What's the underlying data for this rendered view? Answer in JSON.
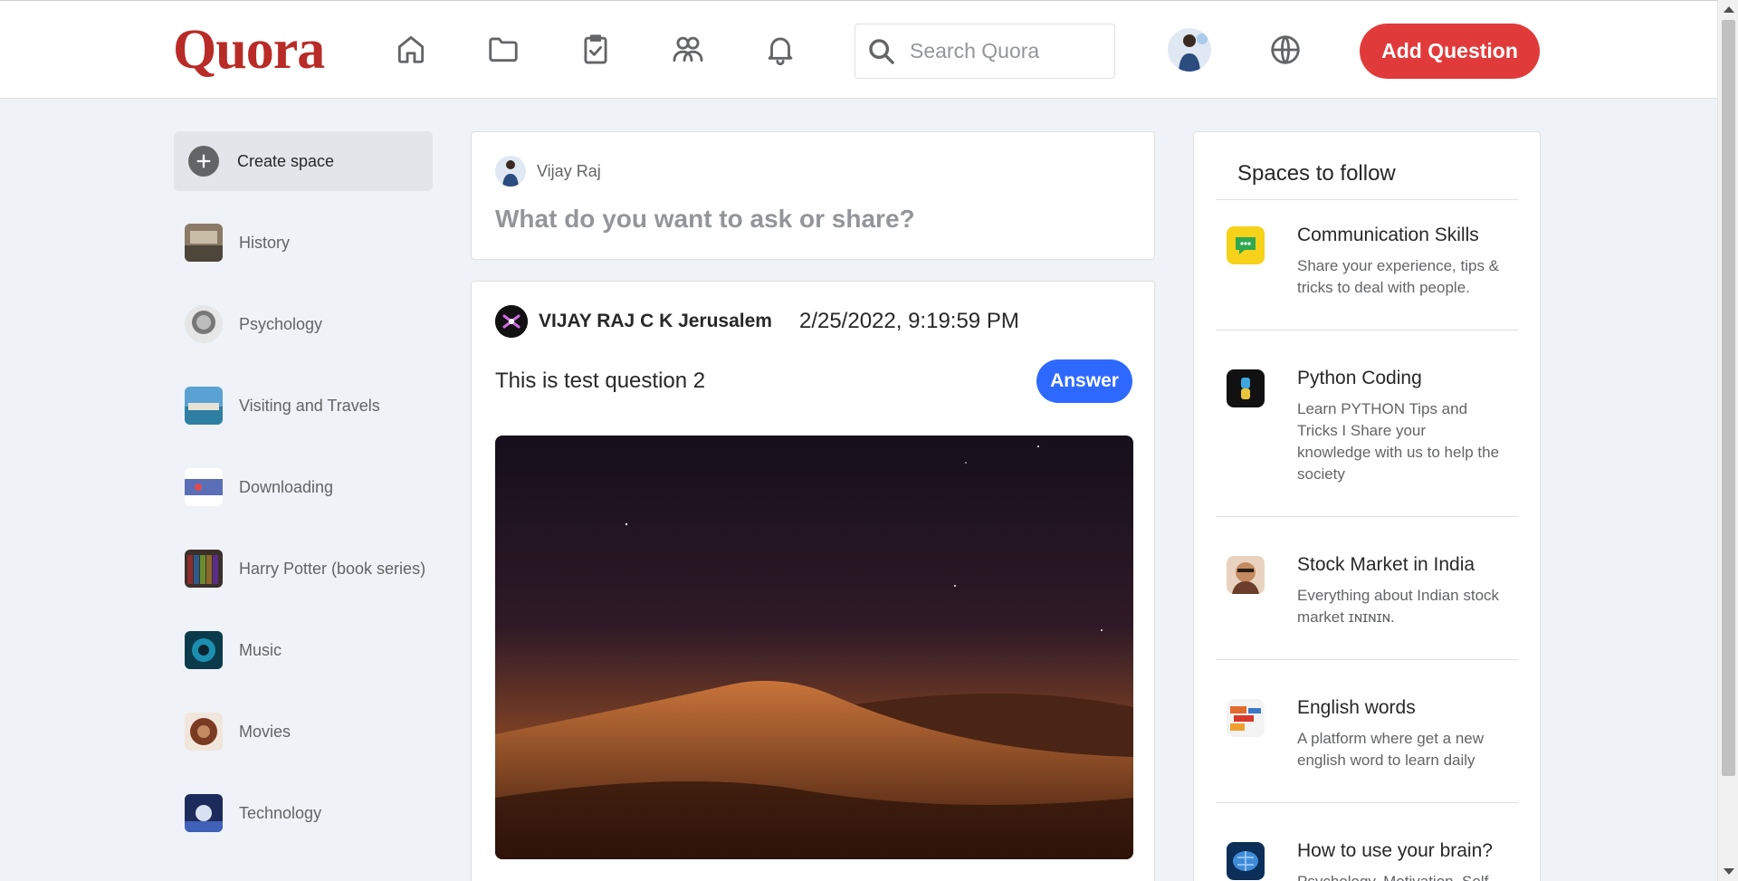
{
  "header": {
    "logo": "Quora",
    "nav_icons": [
      "home-icon",
      "following-icon",
      "answer-icon",
      "spaces-icon",
      "notifications-icon"
    ],
    "search_placeholder": "Search Quora",
    "add_question_label": "Add Question",
    "accent": "#e13a3a"
  },
  "sidebar": {
    "create_space": "Create space",
    "items": [
      {
        "label": "History"
      },
      {
        "label": "Psychology"
      },
      {
        "label": "Visiting and Travels"
      },
      {
        "label": "Downloading"
      },
      {
        "label": "Harry Potter (book series)"
      },
      {
        "label": "Music"
      },
      {
        "label": "Movies"
      },
      {
        "label": "Technology"
      }
    ]
  },
  "ask": {
    "user": "Vijay Raj",
    "placeholder": "What do you want to ask or share?"
  },
  "post": {
    "author": "VIJAY RAJ C K Jerusalem",
    "timestamp": "2/25/2022, 9:19:59 PM",
    "question": "This is test question 2",
    "answer_label": "Answer"
  },
  "spaces": {
    "title": "Spaces to follow",
    "items": [
      {
        "name": "Communication Skills",
        "desc": "Share your experience, tips & tricks to deal with people."
      },
      {
        "name": "Python Coding",
        "desc": "Learn PYTHON Tips and Tricks I Share your knowledge with us to help the society"
      },
      {
        "name": "Stock Market in India",
        "desc": "Everything about Indian stock market ɪɴɪɴɪɴ."
      },
      {
        "name": "English words",
        "desc": "A platform where get a new english word to learn daily"
      },
      {
        "name": "How to use your brain?",
        "desc": "Psychology, Motivation, Self-"
      }
    ]
  }
}
